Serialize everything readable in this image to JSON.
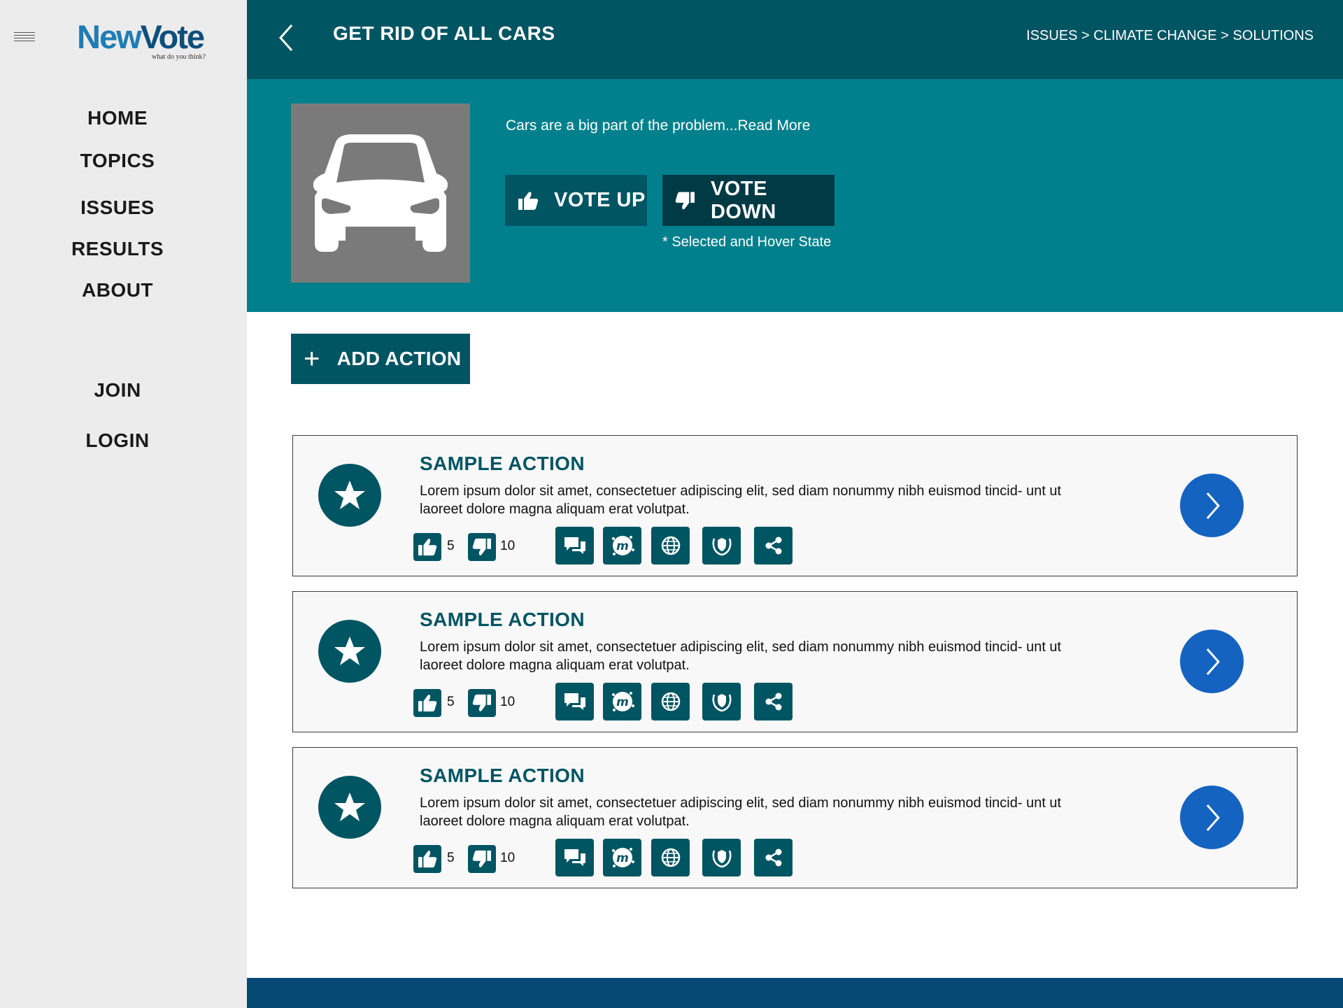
{
  "brand": {
    "name_part1": "New",
    "name_part2": "Vote",
    "tagline": "what do you think?"
  },
  "sidebar": {
    "nav": [
      {
        "label": "HOME"
      },
      {
        "label": "TOPICS"
      },
      {
        "label": "ISSUES"
      },
      {
        "label": "RESULTS"
      },
      {
        "label": "ABOUT"
      }
    ],
    "account": [
      {
        "label": "JOIN"
      },
      {
        "label": "LOGIN"
      }
    ]
  },
  "header": {
    "title": "GET RID OF ALL CARS",
    "breadcrumb": [
      "ISSUES",
      "CLIMATE CHANGE",
      "SOLUTIONS"
    ],
    "breadcrumb_sep": " > "
  },
  "hero": {
    "description": "Cars are a big part of the problem...",
    "read_more": "Read More",
    "vote_up": "VOTE UP",
    "vote_down": "VOTE DOWN",
    "note": "* Selected and Hover State"
  },
  "add_action": {
    "label": "ADD ACTION"
  },
  "actions": [
    {
      "title": "SAMPLE ACTION",
      "body": "Lorem ipsum dolor sit amet, consectetuer adipiscing elit, sed diam nonummy nibh euismod tincid- unt ut laoreet dolore magna aliquam erat volutpat.",
      "up_count": "5",
      "down_count": "10"
    },
    {
      "title": "SAMPLE ACTION",
      "body": "Lorem ipsum dolor sit amet, consectetuer adipiscing elit, sed diam nonummy nibh euismod tincid- unt ut laoreet dolore magna aliquam erat volutpat.",
      "up_count": "5",
      "down_count": "10"
    },
    {
      "title": "SAMPLE ACTION",
      "body": "Lorem ipsum dolor sit amet, consectetuer adipiscing elit, sed diam nonummy nibh euismod tincid- unt ut laoreet dolore magna aliquam erat volutpat.",
      "up_count": "5",
      "down_count": "10"
    }
  ],
  "action_icons": [
    "chat-icon",
    "meetup-icon",
    "globe-icon",
    "shield-icon",
    "share-icon"
  ],
  "colors": {
    "primary": "#005563",
    "hero": "#00808c",
    "selected": "#003a44",
    "go_button": "#1563c0",
    "footer": "#054874",
    "sidebar": "#ececec"
  }
}
